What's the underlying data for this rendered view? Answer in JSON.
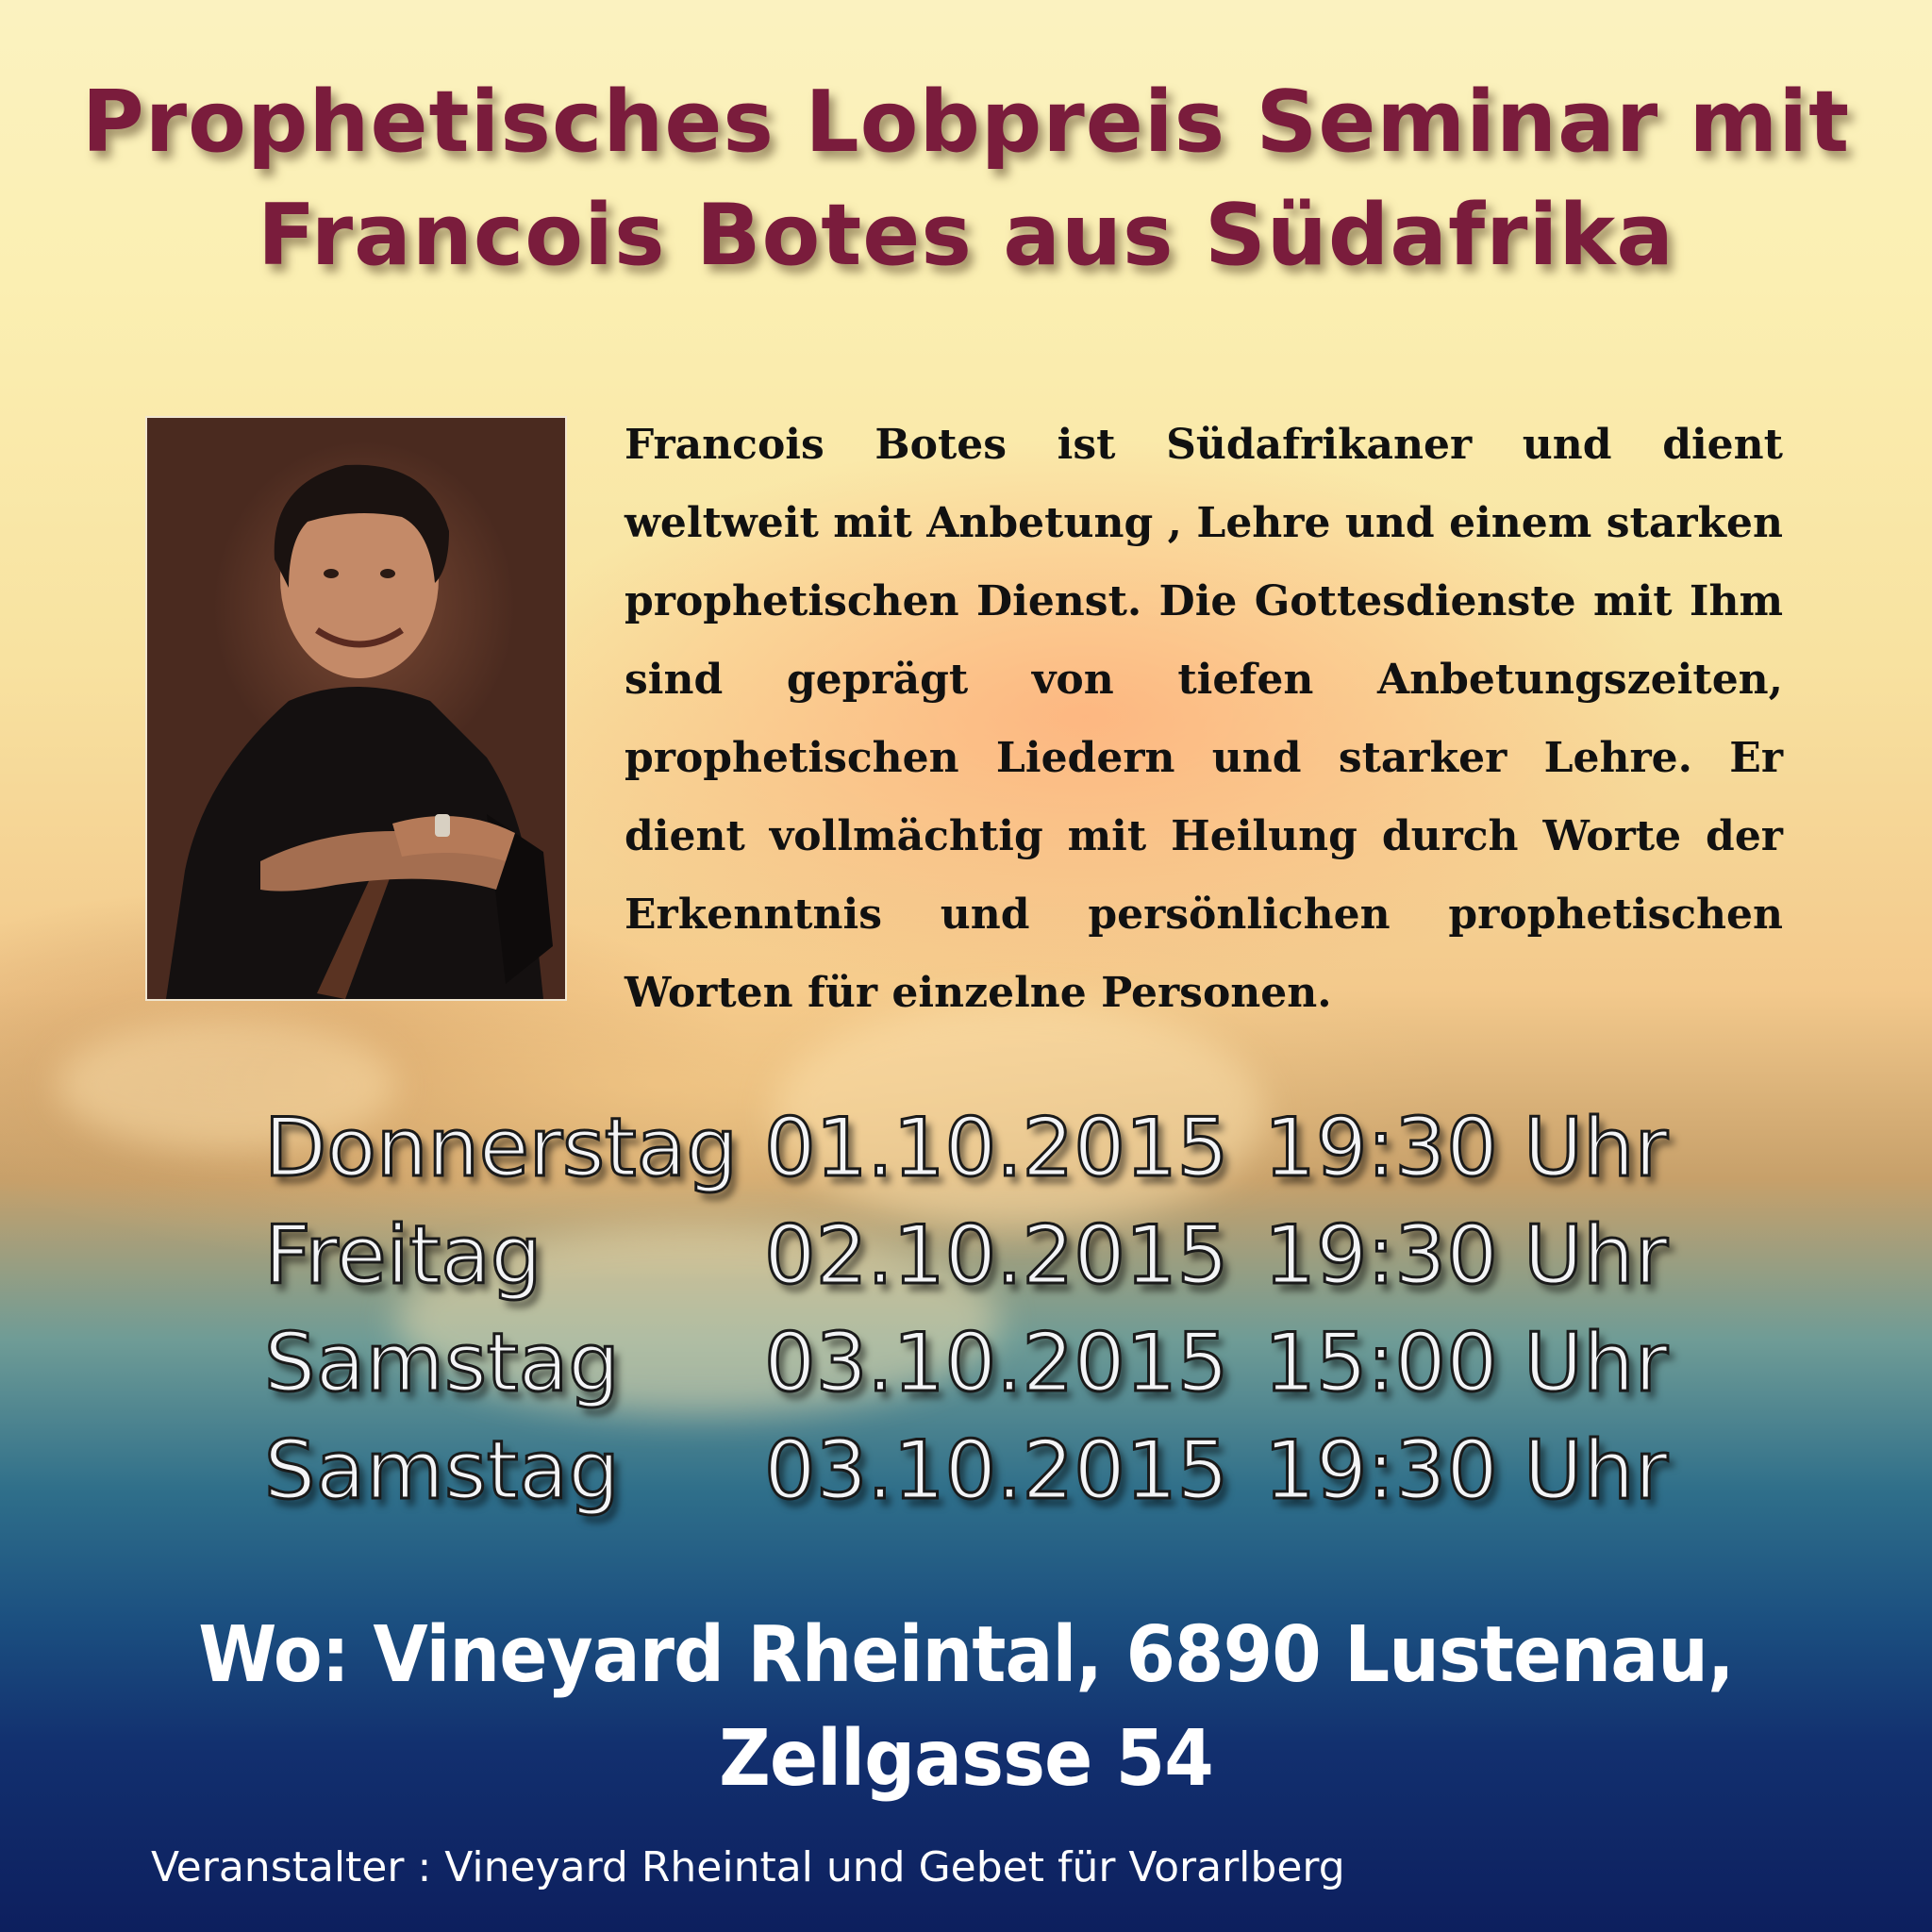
{
  "title": {
    "line1": "Prophetisches Lobpreis Seminar mit",
    "line2": "Francois Botes aus Südafrika"
  },
  "bio": "Francois Botes ist Südafrikaner und dient weltweit mit Anbetung , Lehre und einem starken prophetischen Dienst. Die Gottesdienste mit Ihm sind geprägt von tiefen Anbetungszeiten, prophetischen Liedern und starker Lehre. Er dient vollmächtig mit Heilung durch Worte der Erkenntnis und persönlichen prophetischen Worten für einzelne Personen.",
  "schedule": [
    {
      "day": "Donnerstag",
      "date": "01.10.2015",
      "time": "19:30 Uhr"
    },
    {
      "day": "Freitag",
      "date": "02.10.2015",
      "time": "19:30 Uhr"
    },
    {
      "day": "Samstag",
      "date": "03.10.2015",
      "time": "15:00 Uhr"
    },
    {
      "day": "Samstag",
      "date": "03.10.2015",
      "time": "19:30 Uhr"
    }
  ],
  "where": "Wo: Vineyard Rheintal, 6890 Lustenau, Zellgasse 54",
  "organizer": "Veranstalter : Vineyard Rheintal und Gebet für Vorarlberg",
  "colors": {
    "title": "#7a1c3c",
    "schedule_text": "#f3f4f6",
    "where_text": "#ffffff"
  }
}
